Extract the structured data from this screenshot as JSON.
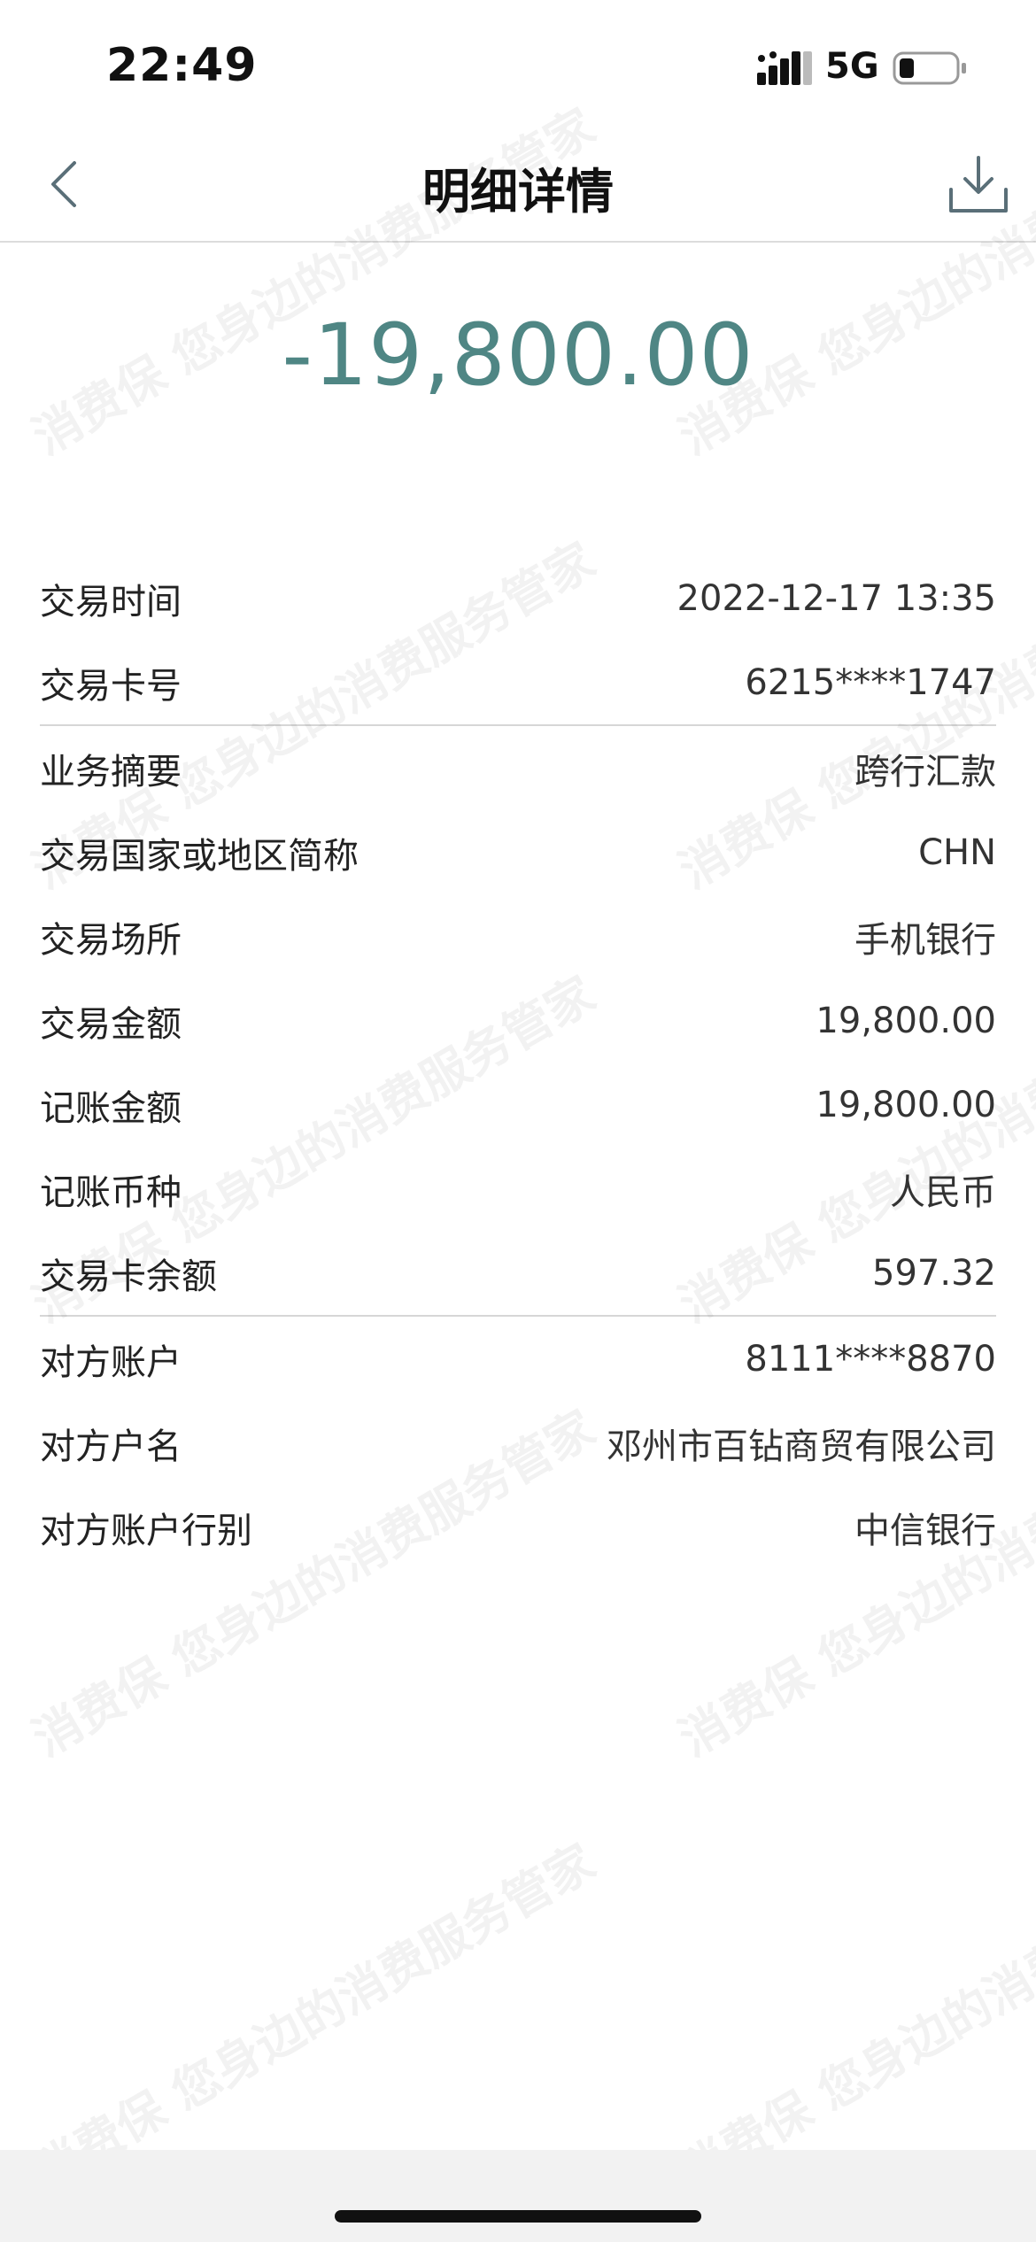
{
  "status_bar": {
    "time": "22:49",
    "network": "5G"
  },
  "nav": {
    "title": "明细详情"
  },
  "amount": "-19,800.00",
  "details": [
    {
      "label": "交易时间",
      "value": "2022-12-17 13:35"
    },
    {
      "label": "交易卡号",
      "value": "6215****1747"
    },
    {
      "label": "业务摘要",
      "value": "跨行汇款"
    },
    {
      "label": "交易国家或地区简称",
      "value": "CHN"
    },
    {
      "label": "交易场所",
      "value": "手机银行"
    },
    {
      "label": "交易金额",
      "value": "19,800.00"
    },
    {
      "label": "记账金额",
      "value": "19,800.00"
    },
    {
      "label": "记账币种",
      "value": "人民币"
    },
    {
      "label": "交易卡余额",
      "value": "597.32"
    },
    {
      "label": "对方账户",
      "value": "8111****8870"
    },
    {
      "label": "对方户名",
      "value": "邓州市百钻商贸有限公司"
    },
    {
      "label": "对方账户行别",
      "value": "中信银行"
    }
  ],
  "watermark": {
    "text": "消费保 您身边的消费服务管家"
  },
  "colors": {
    "amount": "#4f8684",
    "icon": "#5a6f78"
  }
}
